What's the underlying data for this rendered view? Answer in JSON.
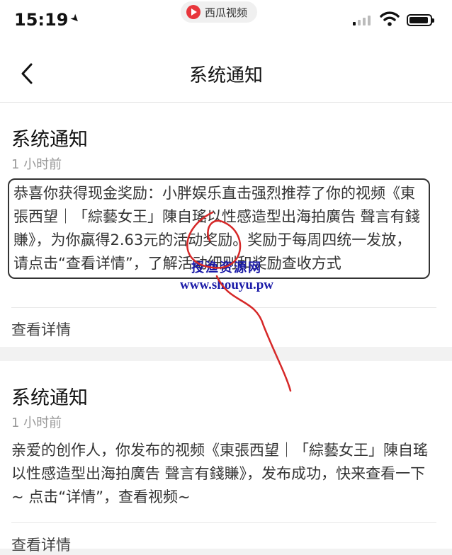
{
  "status_bar": {
    "time": "15:19",
    "app_name": "西瓜视频",
    "icons": [
      "location-arrow-icon",
      "app-logo-icon",
      "signal-icon",
      "wifi-icon",
      "battery-icon"
    ]
  },
  "nav": {
    "title": "系统通知",
    "back_icon": "chevron-left-icon"
  },
  "notifications": [
    {
      "title": "系统通知",
      "time": "1 小时前",
      "body": "恭喜你获得现金奖励：小胖娱乐直击强烈推荐了你的视频《東張西望｜「綜藝女王」陳自瑤以性感造型出海拍廣告 聲言有錢賺》，为你赢得2.63元的活动奖励。奖励于每周四统一发放，请点击“查看详情”，了解活动细则和奖励查收方式",
      "action": "查看详情"
    },
    {
      "title": "系统通知",
      "time": "1 小时前",
      "body": "亲爱的创作人，你发布的视频《東張西望｜「綜藝女王」陳自瑤以性感造型出海拍廣告 聲言有錢賺》，发布成功，快来查看一下~ 点击“详情”，查看视频~",
      "action": "查看详情"
    }
  ],
  "watermark": {
    "text": "授渔资源网",
    "url": "www.shouyu.pw"
  },
  "colors": {
    "accent_red": "#e8363c",
    "watermark_blue": "#1a1aa8",
    "annotation_red": "#d62828"
  }
}
